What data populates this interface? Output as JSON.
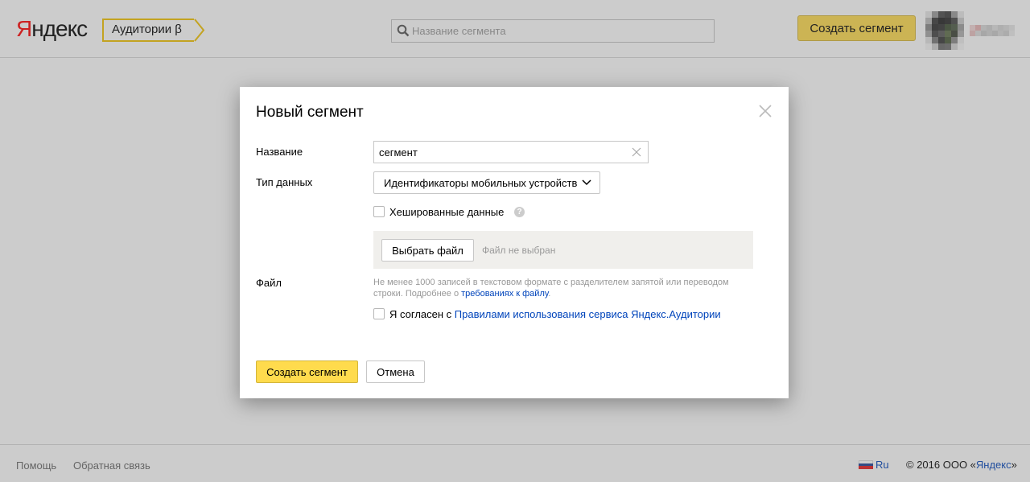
{
  "header": {
    "logo_first": "Я",
    "logo_rest": "ндекс",
    "service_label": "Аудитории β",
    "search_placeholder": "Название сегмента",
    "create_button": "Создать сегмент",
    "icons": {
      "search": "search-icon",
      "avatar": "avatar"
    }
  },
  "modal": {
    "title": "Новый сегмент",
    "name_label": "Название",
    "name_value": "сегмент",
    "type_label": "Тип данных",
    "type_value": "Идентификаторы мобильных устройств",
    "hashed_label": "Хешированные данные",
    "help_glyph": "?",
    "file_label": "Файл",
    "choose_file": "Выбрать файл",
    "file_status": "Файл не выбран",
    "hint_text": "Не менее 1000 записей в текстовом формате с разделителем запятой или переводом строки. Подробнее о ",
    "hint_link": "требованиях к файлу",
    "hint_end": ".",
    "agree_text": "Я согласен с ",
    "agree_link": "Правилами использования сервиса Яндекс.Аудитории",
    "create_button": "Создать сегмент",
    "cancel_button": "Отмена",
    "hashed_checked": false,
    "agree_checked": false,
    "icons": {
      "close": "close-icon",
      "clear": "clear-icon",
      "dropdown": "chevron-down-icon",
      "help": "help-icon"
    }
  },
  "footer": {
    "help": "Помощь",
    "feedback": "Обратная связь",
    "lang": "Ru",
    "copyright_text": "© 2016  ООО «",
    "copyright_link": "Яндекс",
    "copyright_end": "»"
  },
  "colors": {
    "brand_yellow": "#ffdb4d",
    "tag_border": "#f2c200",
    "link": "#0044bb",
    "logo_red": "#ff0000",
    "overlay": "rgba(100,100,100,0.33)"
  }
}
